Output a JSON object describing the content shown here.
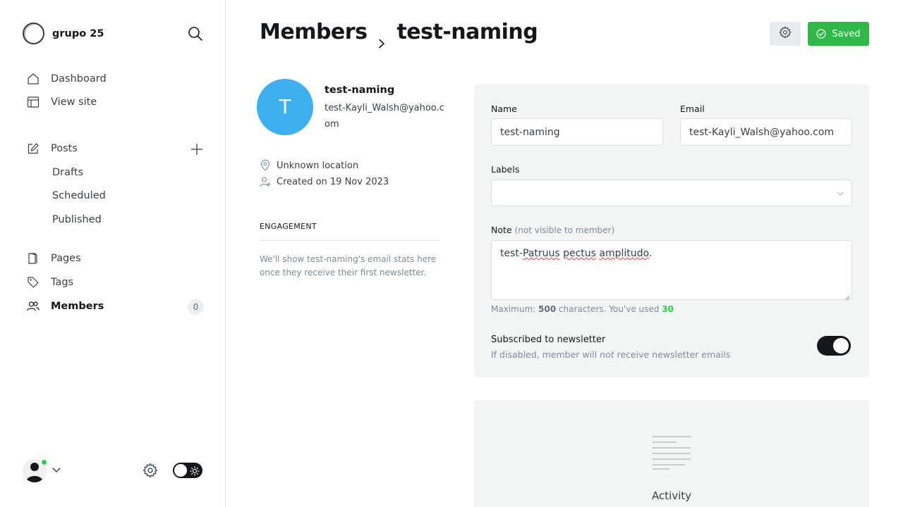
{
  "sidebar": {
    "site_name": "grupo 25",
    "nav": {
      "dashboard": "Dashboard",
      "view_site": "View site",
      "posts": "Posts",
      "drafts": "Drafts",
      "scheduled": "Scheduled",
      "published": "Published",
      "pages": "Pages",
      "tags": "Tags",
      "members": "Members",
      "members_count": "0"
    }
  },
  "header": {
    "breadcrumb_parent": "Members",
    "breadcrumb_current": "test-naming",
    "saved_label": "Saved"
  },
  "profile": {
    "initial": "T",
    "name": "test-naming",
    "email": "test-Kayli_Walsh@yahoo.com",
    "location": "Unknown location",
    "created": "Created on 19 Nov 2023",
    "engagement_heading": "ENGAGEMENT",
    "engagement_text": "We'll show test-naming's email stats here once they receive their first newsletter."
  },
  "form": {
    "name_label": "Name",
    "name_value": "test-naming",
    "email_label": "Email",
    "email_value": "test-Kayli_Walsh@yahoo.com",
    "labels_label": "Labels",
    "labels_value": "",
    "note_label": "Note",
    "note_hint": "(not visible to member)",
    "note_value_prefix": "test-",
    "note_value_words": [
      "Patruus",
      "pectus",
      "amplitudo"
    ],
    "note_value_suffix": ".",
    "max_prefix": "Maximum:",
    "max_value": "500",
    "max_middle": "characters. You've used",
    "used_value": "30",
    "subscribed_title": "Subscribed to newsletter",
    "subscribed_desc_1": "If disabled, member will",
    "subscribed_desc_em": "not",
    "subscribed_desc_2": "receive newsletter emails",
    "subscribed": true
  },
  "activity": {
    "label": "Activity"
  },
  "colors": {
    "accent_green": "#30b849",
    "avatar_blue": "#3eb0ef",
    "online_green": "#30cf43"
  },
  "icons": [
    "search-icon",
    "home-icon",
    "layout-icon",
    "edit-icon",
    "plus-icon",
    "page-icon",
    "tag-icon",
    "members-icon",
    "chevron-down-icon",
    "gear-icon",
    "sun-icon",
    "check-circle-icon",
    "location-icon",
    "user-add-icon",
    "document-lines-icon"
  ]
}
